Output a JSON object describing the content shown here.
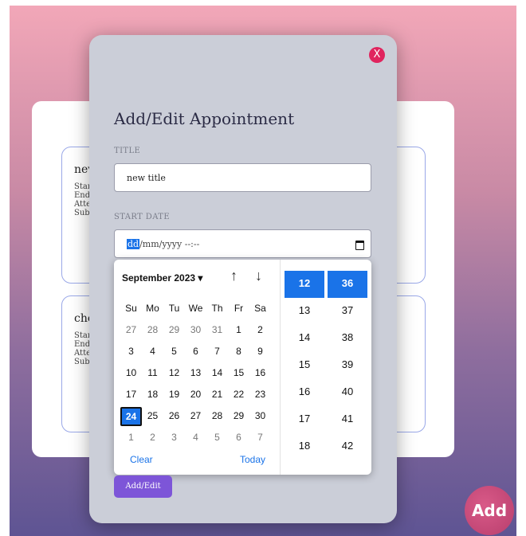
{
  "appointments": [
    {
      "title": "nev",
      "lines": [
        "Star",
        "End",
        "Atte",
        "Sub"
      ]
    },
    {
      "title": "che",
      "lines": [
        "Star",
        "End",
        "Atte",
        "Sub"
      ]
    }
  ],
  "modal": {
    "close_label": "X",
    "title": "Add/Edit Appointment",
    "title_label": "TITLE",
    "title_value": "new title",
    "start_label": "START DATE",
    "start_value": {
      "seg": "dd",
      "rest": "/mm/yyyy --:--"
    },
    "submit_label": "Add/Edit"
  },
  "picker": {
    "month": "September 2023 ▾",
    "up": "↑",
    "down": "↓",
    "weekdays": [
      "Su",
      "Mo",
      "Tu",
      "We",
      "Th",
      "Fr",
      "Sa"
    ],
    "weeks": [
      [
        [
          "27",
          1
        ],
        [
          "28",
          1
        ],
        [
          "29",
          1
        ],
        [
          "30",
          1
        ],
        [
          "31",
          1
        ],
        [
          "1",
          0
        ],
        [
          "2",
          0
        ]
      ],
      [
        [
          "3",
          0
        ],
        [
          "4",
          0
        ],
        [
          "5",
          0
        ],
        [
          "6",
          0
        ],
        [
          "7",
          0
        ],
        [
          "8",
          0
        ],
        [
          "9",
          0
        ]
      ],
      [
        [
          "10",
          0
        ],
        [
          "11",
          0
        ],
        [
          "12",
          0
        ],
        [
          "13",
          0
        ],
        [
          "14",
          0
        ],
        [
          "15",
          0
        ],
        [
          "16",
          0
        ]
      ],
      [
        [
          "17",
          0
        ],
        [
          "18",
          0
        ],
        [
          "19",
          0
        ],
        [
          "20",
          0
        ],
        [
          "21",
          0
        ],
        [
          "22",
          0
        ],
        [
          "23",
          0
        ]
      ],
      [
        [
          "24",
          2
        ],
        [
          "25",
          0
        ],
        [
          "26",
          0
        ],
        [
          "27",
          0
        ],
        [
          "28",
          0
        ],
        [
          "29",
          0
        ],
        [
          "30",
          0
        ]
      ],
      [
        [
          "1",
          1
        ],
        [
          "2",
          1
        ],
        [
          "3",
          1
        ],
        [
          "4",
          1
        ],
        [
          "5",
          1
        ],
        [
          "6",
          1
        ],
        [
          "7",
          1
        ]
      ]
    ],
    "clear": "Clear",
    "today": "Today",
    "hours": [
      "12",
      "13",
      "14",
      "15",
      "16",
      "17",
      "18"
    ],
    "minutes": [
      "36",
      "37",
      "38",
      "39",
      "40",
      "41",
      "42"
    ],
    "selected_hour": "12",
    "selected_minute": "36"
  },
  "add_button": "Add",
  "colors": {
    "accent": "#1a73e8",
    "close": "#e0245e",
    "submit": "#7d55d8",
    "add": "#c94a7a"
  }
}
